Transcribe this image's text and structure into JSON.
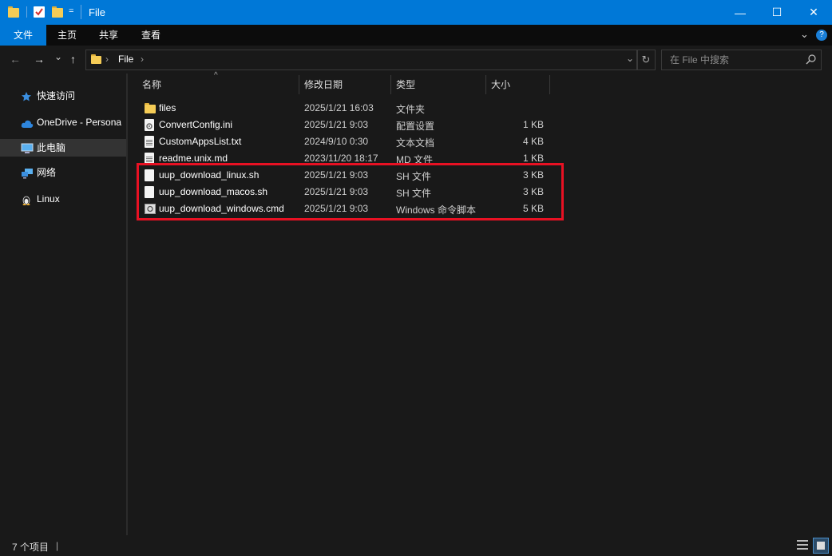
{
  "window": {
    "title": "File",
    "accent_color": "#0078d7",
    "controls": {
      "minimize": "—",
      "maximize": "☐",
      "close": "✕"
    }
  },
  "quick_access_toolbar": {
    "dropdown_glyph": "="
  },
  "ribbon": {
    "tabs": [
      {
        "label": "文件",
        "active": true
      },
      {
        "label": "主页"
      },
      {
        "label": "共享"
      },
      {
        "label": "查看"
      }
    ],
    "expand_glyph": "⌄",
    "help_glyph": "?"
  },
  "address_bar": {
    "back_glyph": "←",
    "forward_glyph": "→",
    "recent_glyph": "⌄",
    "up_glyph": "↑",
    "breadcrumb": [
      "File"
    ],
    "separator_glyph": "›",
    "dropdown_glyph": "⌄",
    "refresh_glyph": "↻"
  },
  "search": {
    "placeholder": "在 File 中搜索"
  },
  "nav_pane": {
    "items": [
      {
        "label": "快速访问",
        "icon": "star-icon"
      },
      {
        "label": "OneDrive - Persona",
        "icon": "cloud-icon"
      },
      {
        "label": "此电脑",
        "icon": "computer-icon",
        "selected": true
      },
      {
        "label": "网络",
        "icon": "network-icon"
      },
      {
        "label": "Linux",
        "icon": "linux-penguin-icon"
      }
    ]
  },
  "file_list": {
    "sort_glyph": "^",
    "columns": [
      "名称",
      "修改日期",
      "类型",
      "大小"
    ],
    "rows": [
      {
        "name": "files",
        "date": "2025/1/21 16:03",
        "type": "文件夹",
        "size": "",
        "icon": "folder-icon"
      },
      {
        "name": "ConvertConfig.ini",
        "date": "2025/1/21 9:03",
        "type": "配置设置",
        "size": "1 KB",
        "icon": "config-file-icon"
      },
      {
        "name": "CustomAppsList.txt",
        "date": "2024/9/10 0:30",
        "type": "文本文档",
        "size": "4 KB",
        "icon": "text-file-icon"
      },
      {
        "name": "readme.unix.md",
        "date": "2023/11/20 18:17",
        "type": "MD 文件",
        "size": "1 KB",
        "icon": "md-file-icon"
      },
      {
        "name": "uup_download_linux.sh",
        "date": "2025/1/21 9:03",
        "type": "SH 文件",
        "size": "3 KB",
        "icon": "sh-file-icon"
      },
      {
        "name": "uup_download_macos.sh",
        "date": "2025/1/21 9:03",
        "type": "SH 文件",
        "size": "3 KB",
        "icon": "sh-file-icon"
      },
      {
        "name": "uup_download_windows.cmd",
        "date": "2025/1/21 9:03",
        "type": "Windows 命令脚本",
        "size": "5 KB",
        "icon": "cmd-file-icon"
      }
    ],
    "highlight_color": "#e81123"
  },
  "status_bar": {
    "item_count": "7 个项目",
    "separator": "|"
  }
}
